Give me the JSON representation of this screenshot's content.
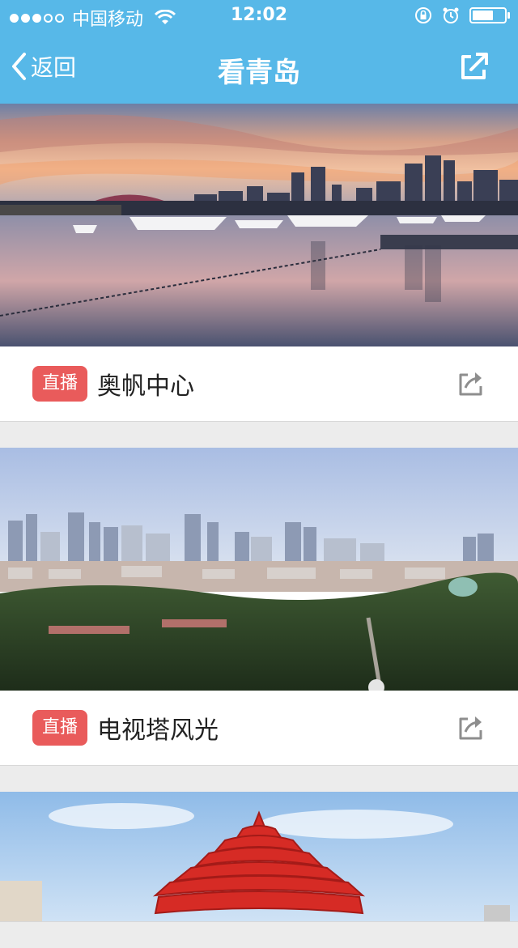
{
  "status_bar": {
    "signal_filled": 3,
    "signal_empty": 2,
    "carrier": "中国移动",
    "time": "12:02",
    "battery_level": 0.65
  },
  "navbar": {
    "back_label": "返回",
    "title": "看青岛",
    "share_icon": "share-icon"
  },
  "cards": [
    {
      "badge": "直播",
      "title": "奥帆中心",
      "image": "marina-sunset-photo",
      "share_icon": "share-icon"
    },
    {
      "badge": "直播",
      "title": "电视塔风光",
      "image": "city-skyline-photo",
      "share_icon": "share-icon"
    },
    {
      "badge": "",
      "title": "",
      "image": "red-sculpture-photo",
      "share_icon": "share-icon"
    }
  ],
  "colors": {
    "header": "#57b8e8",
    "badge": "#e95b5b",
    "background": "#ececec"
  }
}
